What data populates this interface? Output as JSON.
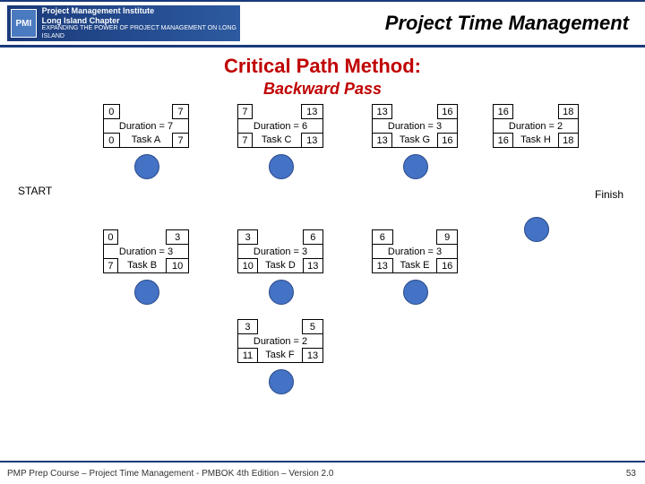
{
  "header": {
    "logo_org": "Project Management Institute",
    "logo_chapter": "Long Island Chapter",
    "logo_tagline": "EXPANDING THE POWER OF PROJECT MANAGEMENT ON LONG ISLAND",
    "logo_badge": "PMI",
    "title": "Project Time Management"
  },
  "subtitle": "Critical Path Method:",
  "subtitle2": "Backward Pass",
  "labels": {
    "start": "START",
    "finish": "Finish"
  },
  "tasks": {
    "A": {
      "es": "0",
      "ef": "7",
      "dur": "Duration = 7",
      "name": "Task A",
      "ls": "0",
      "lf": "7"
    },
    "C": {
      "es": "7",
      "ef": "13",
      "dur": "Duration = 6",
      "name": "Task C",
      "ls": "7",
      "lf": "13"
    },
    "G": {
      "es": "13",
      "ef": "16",
      "dur": "Duration = 3",
      "name": "Task G",
      "ls": "13",
      "lf": "16"
    },
    "H": {
      "es": "16",
      "ef": "18",
      "dur": "Duration = 2",
      "name": "Task H",
      "ls": "16",
      "lf": "18"
    },
    "B": {
      "es": "0",
      "ef": "3",
      "dur": "Duration = 3",
      "name": "Task B",
      "ls": "7",
      "lf": "10"
    },
    "D": {
      "es": "3",
      "ef": "6",
      "dur": "Duration = 3",
      "name": "Task D",
      "ls": "10",
      "lf": "13"
    },
    "E": {
      "es": "6",
      "ef": "9",
      "dur": "Duration = 3",
      "name": "Task E",
      "ls": "13",
      "lf": "16"
    },
    "F": {
      "es": "3",
      "ef": "5",
      "dur": "Duration = 2",
      "name": "Task F",
      "ls": "11",
      "lf": "13"
    }
  },
  "footer": "PMP Prep Course – Project Time Management - PMBOK 4th Edition – Version 2.0",
  "page_number": "53",
  "chart_data": {
    "type": "network-diagram",
    "title": "Critical Path Method: Backward Pass",
    "nodes": [
      {
        "id": "START",
        "type": "start"
      },
      {
        "id": "A",
        "name": "Task A",
        "duration": 7,
        "es": 0,
        "ef": 7,
        "ls": 0,
        "lf": 7
      },
      {
        "id": "B",
        "name": "Task B",
        "duration": 3,
        "es": 0,
        "ef": 3,
        "ls": 7,
        "lf": 10
      },
      {
        "id": "C",
        "name": "Task C",
        "duration": 6,
        "es": 7,
        "ef": 13,
        "ls": 7,
        "lf": 13
      },
      {
        "id": "D",
        "name": "Task D",
        "duration": 3,
        "es": 3,
        "ef": 6,
        "ls": 10,
        "lf": 13
      },
      {
        "id": "F",
        "name": "Task F",
        "duration": 2,
        "es": 3,
        "ef": 5,
        "ls": 11,
        "lf": 13
      },
      {
        "id": "G",
        "name": "Task G",
        "duration": 3,
        "es": 13,
        "ef": 16,
        "ls": 13,
        "lf": 16
      },
      {
        "id": "E",
        "name": "Task E",
        "duration": 3,
        "es": 6,
        "ef": 9,
        "ls": 13,
        "lf": 16
      },
      {
        "id": "H",
        "name": "Task H",
        "duration": 2,
        "es": 16,
        "ef": 18,
        "ls": 16,
        "lf": 18
      },
      {
        "id": "Finish",
        "type": "finish"
      }
    ],
    "edges": [
      [
        "START",
        "A"
      ],
      [
        "START",
        "B"
      ],
      [
        "A",
        "C"
      ],
      [
        "B",
        "D"
      ],
      [
        "B",
        "F"
      ],
      [
        "C",
        "G"
      ],
      [
        "D",
        "G"
      ],
      [
        "D",
        "E"
      ],
      [
        "F",
        "G"
      ],
      [
        "G",
        "H"
      ],
      [
        "E",
        "H"
      ],
      [
        "H",
        "Finish"
      ]
    ]
  }
}
